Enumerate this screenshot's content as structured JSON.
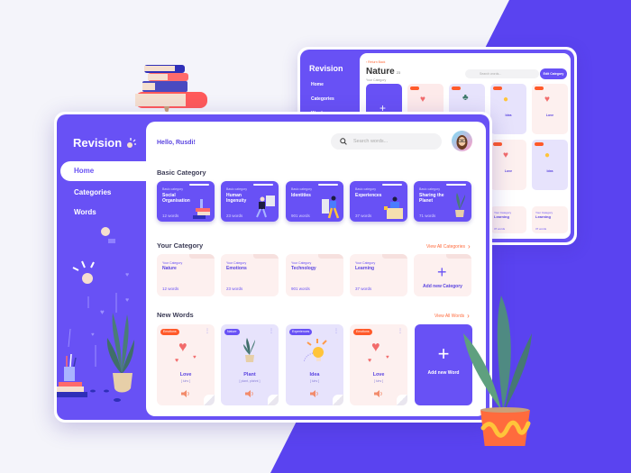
{
  "back_window": {
    "app_name": "Revision",
    "nav": [
      "Home",
      "Categories",
      "Words"
    ],
    "return_link": "Return Back",
    "title": "Nature",
    "count": "23",
    "subtitle": "Your Category",
    "search_placeholder": "Search words...",
    "edit_button": "Edit Category",
    "word_cards": [
      {
        "word": "Love",
        "tag_color": "#ff5a2a"
      },
      {
        "word": "Plant",
        "tag_color": "#ff5a2a"
      },
      {
        "word": "Idea",
        "tag_color": "#ff5a2a"
      },
      {
        "word": "Love",
        "tag_color": "#ff5a2a"
      },
      {
        "word": "Love",
        "tag_color": "#ff5a2a"
      },
      {
        "word": "Idea",
        "tag_color": "#ff5a2a"
      }
    ],
    "learning_cards": [
      {
        "label": "Your Category",
        "name": "Learning",
        "count": "37 words"
      },
      {
        "label": "Your Category",
        "name": "Learning",
        "count": "37 words"
      }
    ]
  },
  "app": {
    "name": "Revision",
    "greeting": "Hello, Rusdi!",
    "search_placeholder": "Search words...",
    "accent": "#6851f5",
    "secondary": "#ff6b3d"
  },
  "sidebar": {
    "items": [
      {
        "label": "Home",
        "active": true
      },
      {
        "label": "Categories",
        "active": false
      },
      {
        "label": "Words",
        "active": false
      }
    ]
  },
  "basic_category": {
    "title": "Basic Category",
    "cards": [
      {
        "label": "Basic category",
        "name": "Social Organisation",
        "count": "12 words"
      },
      {
        "label": "Basic category",
        "name": "Human Ingenuity",
        "count": "23 words"
      },
      {
        "label": "Basic category",
        "name": "Identities",
        "count": "901 words"
      },
      {
        "label": "Basic category",
        "name": "Experiences",
        "count": "37 words"
      },
      {
        "label": "Basic category",
        "name": "Sharing the Planet",
        "count": "71 words"
      }
    ]
  },
  "your_category": {
    "title": "Your Category",
    "view_all": "View All Categories",
    "cards": [
      {
        "label": "Your Category",
        "name": "Nature",
        "count": "12 words"
      },
      {
        "label": "Your Category",
        "name": "Emotions",
        "count": "23 words"
      },
      {
        "label": "Your Category",
        "name": "Technology",
        "count": "901 words"
      },
      {
        "label": "Your Category",
        "name": "Learning",
        "count": "37 words"
      }
    ],
    "add_label": "Add new Category"
  },
  "new_words": {
    "title": "New Words",
    "view_all": "View All Words",
    "cards": [
      {
        "tag": "Emotions",
        "word": "Love",
        "pronunciation": "[ luhv ]"
      },
      {
        "tag": "Nature",
        "word": "Plant",
        "pronunciation": "[ plant, plahnt ]"
      },
      {
        "tag": "Experiences",
        "word": "Idea",
        "pronunciation": "[ luhv ]"
      },
      {
        "tag": "Emotions",
        "word": "Love",
        "pronunciation": "[ luhv ]"
      }
    ],
    "add_label": "Add new Word"
  }
}
